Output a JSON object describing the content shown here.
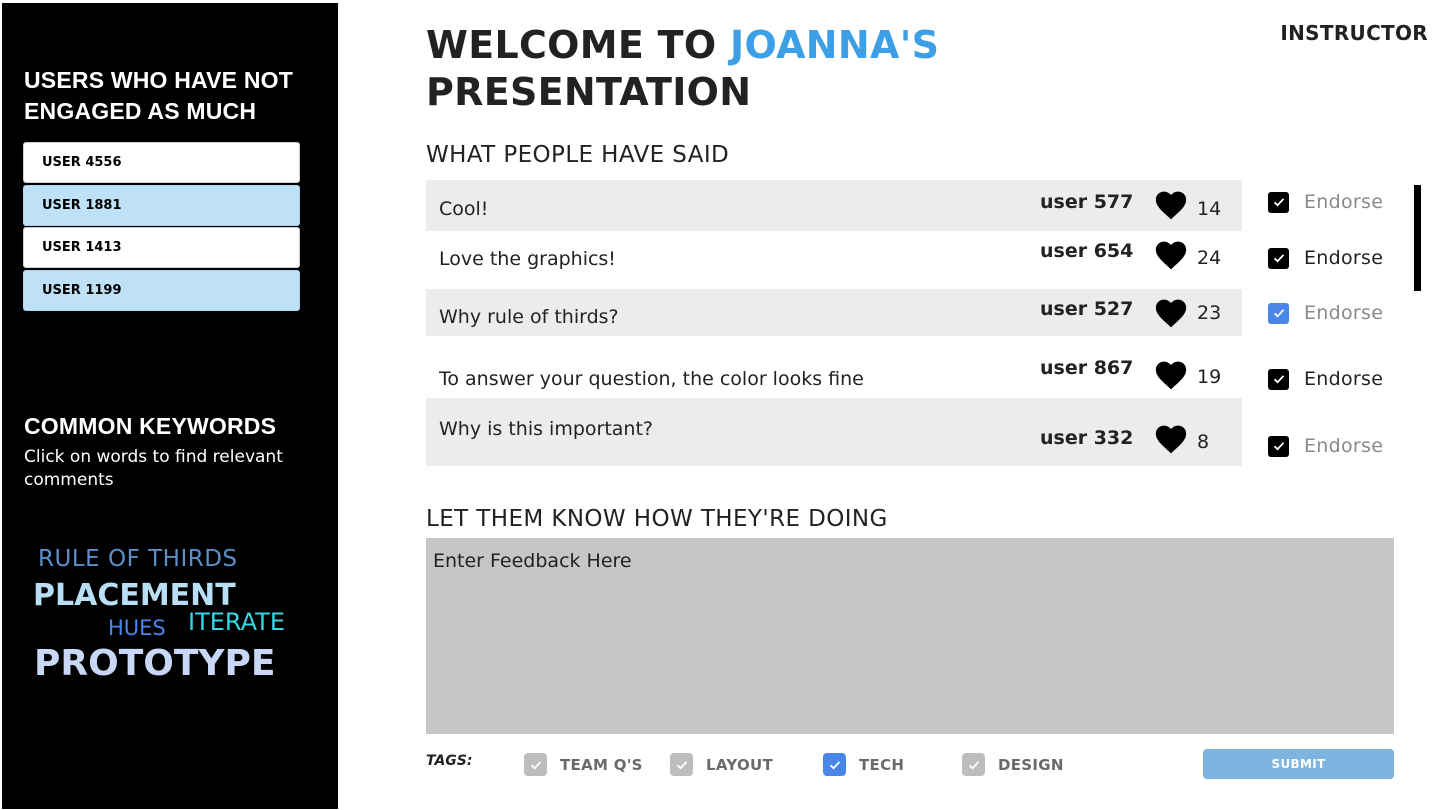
{
  "header": {
    "title_prefix": "WELCOME TO ",
    "title_accent": "JOANNA'S",
    "title_line2": "PRESENTATION",
    "role": "INSTRUCTOR"
  },
  "sidebar": {
    "heading": "USERS WHO HAVE NOT ENGAGED AS MUCH",
    "users": [
      "USER 4556",
      "USER 1881",
      "USER 1413",
      "USER 1199"
    ],
    "keywords_heading": "COMMON KEYWORDS",
    "keywords_subtext": "Click on words to find relevant comments",
    "keywords": {
      "rule_of_thirds": "RULE OF THIRDS",
      "placement": "PLACEMENT",
      "hues": "HUES",
      "iterate": "ITERATE",
      "prototype": "PROTOTYPE"
    }
  },
  "comments_section": {
    "heading": "WHAT PEOPLE HAVE SAID",
    "endorse_label": "Endorse",
    "comments": [
      {
        "text": "Cool!",
        "user": "user 577",
        "likes": "14",
        "endorsed": true
      },
      {
        "text": "Love the graphics!",
        "user": "user 654",
        "likes": "24",
        "endorsed": true
      },
      {
        "text": "Why rule of thirds?",
        "user": "user 527",
        "likes": "23",
        "endorsed": true
      },
      {
        "text": "To answer your question, the color looks fine",
        "user": "user 867",
        "likes": "19",
        "endorsed": true
      },
      {
        "text": "Why is this important?",
        "user": "user 332",
        "likes": "8",
        "endorsed": true
      }
    ]
  },
  "feedback": {
    "heading": "LET THEM KNOW HOW THEY'RE DOING",
    "placeholder": "Enter Feedback Here",
    "tags_label": "TAGS:",
    "tags": [
      {
        "label": "TEAM Q'S",
        "checked": true
      },
      {
        "label": "LAYOUT",
        "checked": true
      },
      {
        "label": "TECH",
        "checked": true
      },
      {
        "label": "DESIGN",
        "checked": true
      }
    ],
    "submit_label": "SUBMIT"
  },
  "colors": {
    "accent": "#3da0e6",
    "sidebar_bg": "#000000",
    "user_highlight": "#bfe1f8",
    "comment_shade": "#ececec",
    "feedback_bg": "#c6c6c6",
    "submit_bg": "#7db5e0",
    "checkbox_blue": "#4a86e8"
  }
}
